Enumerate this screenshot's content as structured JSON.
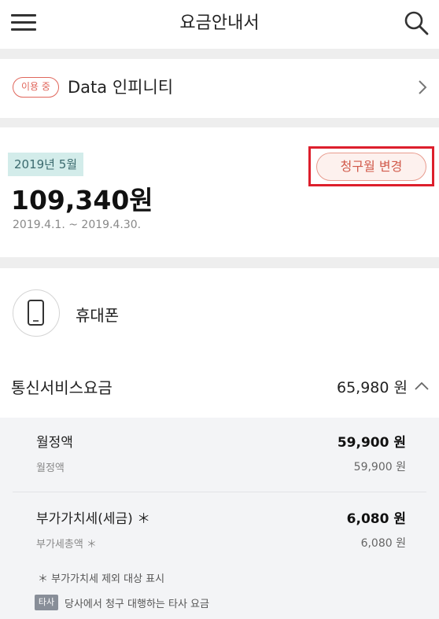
{
  "header": {
    "title": "요금안내서",
    "menu_icon": "hamburger-menu-icon",
    "search_icon": "search-icon"
  },
  "plan": {
    "badge": "이용 중",
    "name": "Data 인피니티",
    "chevron_icon": "chevron-right-icon"
  },
  "billing": {
    "month": "2019년 5월",
    "amount": "109,340원",
    "period": "2019.4.1. ~ 2019.4.30.",
    "change_month_label": "청구월 변경"
  },
  "device": {
    "icon": "smartphone-icon",
    "label": "휴대폰"
  },
  "section": {
    "title": "통신서비스요금",
    "amount": "65,980 원",
    "chevron_icon": "chevron-up-icon"
  },
  "items": [
    {
      "title": "월정액",
      "value": "59,900 원",
      "sub_label": "월정액",
      "sub_value": "59,900 원"
    },
    {
      "title": "부가가치세(세금) ＊",
      "value": "6,080 원",
      "sub_label": "부가세총액 ＊",
      "sub_value": "6,080 원"
    }
  ],
  "footnote": {
    "vat_note": "＊ 부가가치세 제외 대상 표시",
    "other_badge": "타사",
    "other_text": "당사에서 청구 대행하는 타사 요금"
  },
  "colors": {
    "accent": "#e0675c",
    "highlight_border": "#dd1f2c",
    "month_tag_bg": "#d3ecea"
  }
}
